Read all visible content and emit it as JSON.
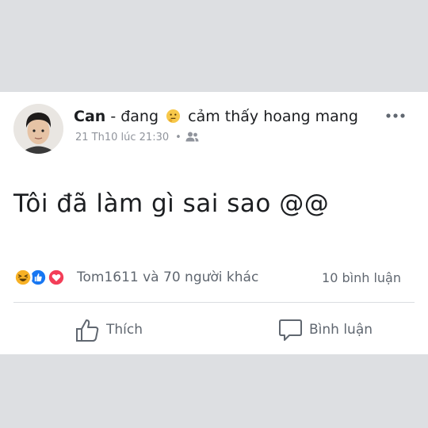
{
  "post": {
    "author": "Can",
    "feeling_prefix": " - đang",
    "feeling_emoji": "thinking-face",
    "feeling_text": "cảm thấy hoang mang",
    "timestamp": "21 Th10 lúc 21:30",
    "meta_dot": "•",
    "audience_icon": "friends-icon",
    "text": "Tôi đã làm gì sai sao @@"
  },
  "reactions": {
    "icons": [
      "haha",
      "like",
      "love"
    ],
    "summary": "Tom1611 và 70 người khác",
    "comments": "10 bình luận"
  },
  "actions": {
    "like_label": "Thích",
    "comment_label": "Bình luận"
  },
  "colors": {
    "like_blue": "#1877f2",
    "love_red": "#f33e58",
    "haha_yellow": "#f7b125",
    "muted_text": "#606770"
  }
}
